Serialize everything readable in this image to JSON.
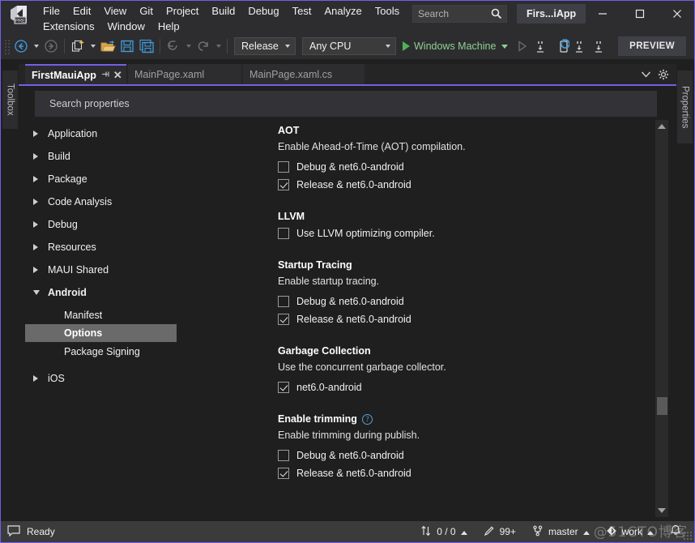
{
  "window": {
    "title": "Firs...iApp",
    "logo_icon": "visual-studio-preview-logo",
    "minimize_icon": "minimize-icon",
    "maximize_icon": "maximize-icon",
    "close_icon": "close-icon"
  },
  "menu": {
    "row1": [
      "File",
      "Edit",
      "View",
      "Git",
      "Project",
      "Build",
      "Debug",
      "Test",
      "Analyze",
      "Tools"
    ],
    "row2": [
      "Extensions",
      "Window",
      "Help"
    ]
  },
  "search": {
    "placeholder": "Search",
    "icon": "magnifier-icon"
  },
  "toolbar": {
    "nav_back_icon": "navigate-back-icon",
    "nav_forward_icon": "navigate-forward-icon",
    "new_item_icon": "new-item-icon",
    "open_icon": "open-file-icon",
    "save_icon": "save-icon",
    "save_all_icon": "save-all-icon",
    "undo_icon": "undo-icon",
    "redo_icon": "redo-icon",
    "configuration": "Release",
    "platform": "Any CPU",
    "run_target": "Windows Machine",
    "run_icon": "play-icon",
    "run_without_debug_icon": "play-outline-icon",
    "step_icons": [
      "step-into-icon",
      "hot-reload-icon",
      "step-over-icon",
      "step-out-icon"
    ],
    "feedback_icon": "feedback-icon",
    "preview_label": "PREVIEW"
  },
  "docktabs": {
    "left_label": "Toolbox",
    "right_label": "Properties"
  },
  "tabs": [
    {
      "label": "FirstMauiApp",
      "active": true,
      "pin_icon": "pin-icon",
      "close_icon": "close-tab-icon"
    },
    {
      "label": "MainPage.xaml",
      "active": false
    },
    {
      "label": "MainPage.xaml.cs",
      "active": false
    }
  ],
  "tabstrip_actions": {
    "dropdown_icon": "chevron-down-icon",
    "settings_icon": "gear-icon"
  },
  "properties": {
    "search_placeholder": "Search properties",
    "tree": [
      {
        "label": "Application",
        "expanded": false,
        "level": 0,
        "selected": false
      },
      {
        "label": "Build",
        "expanded": false,
        "level": 0,
        "selected": false
      },
      {
        "label": "Package",
        "expanded": false,
        "level": 0,
        "selected": false
      },
      {
        "label": "Code Analysis",
        "expanded": false,
        "level": 0,
        "selected": false
      },
      {
        "label": "Debug",
        "expanded": false,
        "level": 0,
        "selected": false
      },
      {
        "label": "Resources",
        "expanded": false,
        "level": 0,
        "selected": false
      },
      {
        "label": "MAUI Shared",
        "expanded": false,
        "level": 0,
        "selected": false
      },
      {
        "label": "Android",
        "expanded": true,
        "level": 0,
        "selected": false
      },
      {
        "label": "Manifest",
        "level": 1,
        "selected": false
      },
      {
        "label": "Options",
        "level": 1,
        "selected": true
      },
      {
        "label": "Package Signing",
        "level": 1,
        "selected": false
      },
      {
        "label": "iOS",
        "expanded": false,
        "level": 0,
        "selected": false
      }
    ],
    "sections": [
      {
        "title": "AOT",
        "description": "Enable Ahead-of-Time (AOT) compilation.",
        "help": false,
        "options": [
          {
            "label": "Debug & net6.0-android",
            "checked": false
          },
          {
            "label": "Release & net6.0-android",
            "checked": true
          }
        ]
      },
      {
        "title": "LLVM",
        "description": "",
        "help": false,
        "options": [
          {
            "label": "Use LLVM optimizing compiler.",
            "checked": false
          }
        ]
      },
      {
        "title": "Startup Tracing",
        "description": "Enable startup tracing.",
        "help": false,
        "options": [
          {
            "label": "Debug & net6.0-android",
            "checked": false
          },
          {
            "label": "Release & net6.0-android",
            "checked": true
          }
        ]
      },
      {
        "title": "Garbage Collection",
        "description": "Use the concurrent garbage collector.",
        "help": false,
        "options": [
          {
            "label": "net6.0-android",
            "checked": true
          }
        ]
      },
      {
        "title": "Enable trimming",
        "description": "Enable trimming during publish.",
        "help": true,
        "help_icon": "help-circle-icon",
        "options": [
          {
            "label": "Debug & net6.0-android",
            "checked": false
          },
          {
            "label": "Release & net6.0-android",
            "checked": true
          }
        ]
      }
    ],
    "scrollbar": {
      "up_icon": "scroll-up-icon",
      "down_icon": "scroll-down-icon"
    }
  },
  "statusbar": {
    "status_icon": "notify-icon",
    "status_text": "Ready",
    "source_control_changes_icon": "up-down-arrows-icon",
    "source_control_changes": "0 / 0",
    "pending_edits_icon": "pencil-icon",
    "pending_edits": "99+",
    "branch_icon": "branch-icon",
    "branch": "master",
    "repo_icon": "repository-icon",
    "repo": "work",
    "bell_icon": "bell-icon",
    "watermark": "@51CTO博客"
  },
  "colors": {
    "accent": "#7160e8",
    "titlebar_bg": "#2d2d30",
    "editor_bg": "#1f1f1f",
    "statusbar_bg": "#3b3b3c",
    "run_green": "#52b052",
    "selection_bg": "#6a6a6a"
  }
}
